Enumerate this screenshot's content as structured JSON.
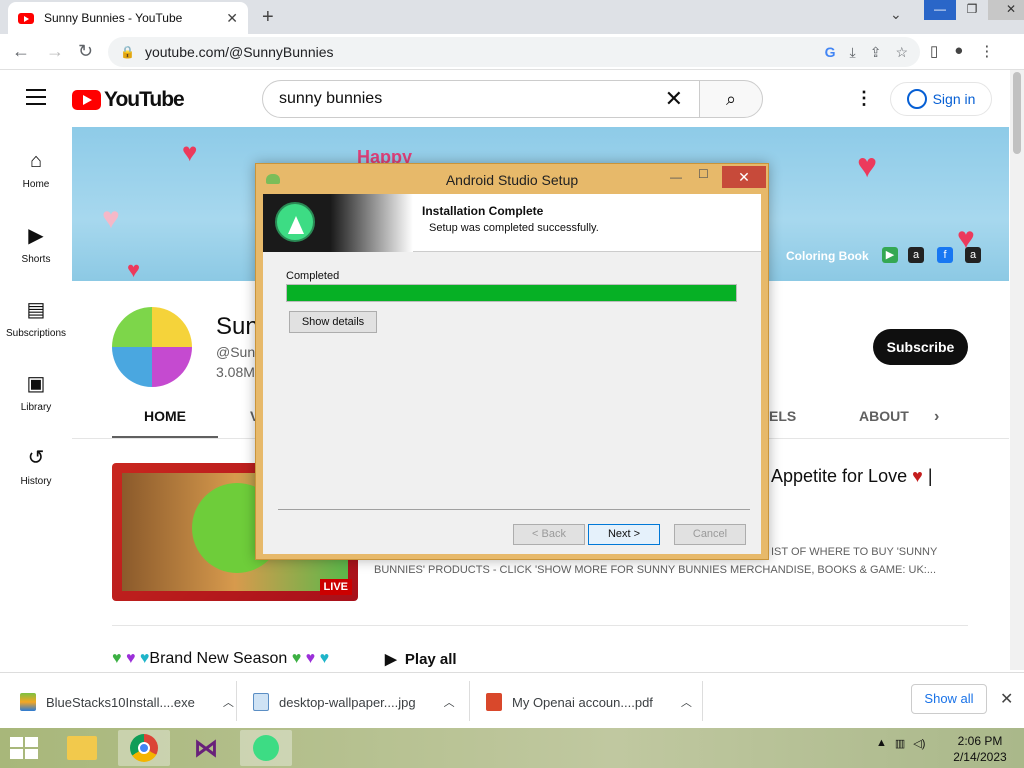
{
  "browser": {
    "tab_title": "Sunny Bunnies - YouTube",
    "url": "youtube.com/@SunnyBunnies"
  },
  "youtube": {
    "logo_text": "YouTube",
    "search_value": "sunny bunnies",
    "sign_in": "Sign in",
    "sidebar": [
      {
        "label": "Home",
        "icon": "home-icon"
      },
      {
        "label": "Shorts",
        "icon": "shorts-icon"
      },
      {
        "label": "Subscriptions",
        "icon": "subscriptions-icon"
      },
      {
        "label": "Library",
        "icon": "library-icon"
      },
      {
        "label": "History",
        "icon": "history-icon"
      }
    ],
    "banner": {
      "happy_text": "Happy",
      "coloring_book": "Coloring Book"
    },
    "channel": {
      "name": "Sun",
      "handle": "@Sunn",
      "subs": "3.08M",
      "subscribe": "Subscribe"
    },
    "tabs": {
      "home": "HOME",
      "videos_partial": "V",
      "channels_partial": "ELS",
      "about": "ABOUT"
    },
    "featured": {
      "title_partial": "Appetite for Love",
      "title_tail": "|",
      "live": "LIVE",
      "desc_line1": "IST OF WHERE TO BUY 'SUNNY",
      "desc_line2": "BUNNIES' PRODUCTS - CLICK 'SHOW MORE FOR SUNNY BUNNIES MERCHANDISE, BOOKS & GAME: UK:..."
    },
    "playlist": {
      "title": "Brand New Season",
      "play_all": "Play all"
    }
  },
  "downloads": {
    "items": [
      {
        "name": "BlueStacks10Install....exe"
      },
      {
        "name": "desktop-wallpaper....jpg"
      },
      {
        "name": "My Openai accoun....pdf"
      }
    ],
    "show_all": "Show all"
  },
  "taskbar": {
    "time": "2:06 PM",
    "date": "2/14/2023"
  },
  "dialog": {
    "title": "Android Studio Setup",
    "heading": "Installation Complete",
    "subheading": "Setup was completed successfully.",
    "status": "Completed",
    "progress": 1.0,
    "show_details": "Show details",
    "back": "< Back",
    "next": "Next >",
    "cancel": "Cancel"
  }
}
